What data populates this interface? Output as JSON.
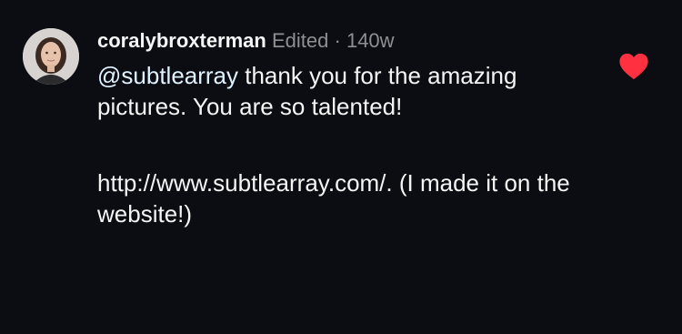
{
  "comment": {
    "username": "coralybroxterman",
    "edited_label": "Edited",
    "separator": "·",
    "age": "140w",
    "mention": "@subtlearray",
    "text_line1_rest": " thank you for the amazing",
    "text_line2": "pictures. You are so talented!",
    "link": "http://www.subtlearray.com/",
    "link_suffix": ". (I made it on the",
    "text_line4": "website!)",
    "like_icon": "heart-icon",
    "like_color": "#ff3040"
  }
}
